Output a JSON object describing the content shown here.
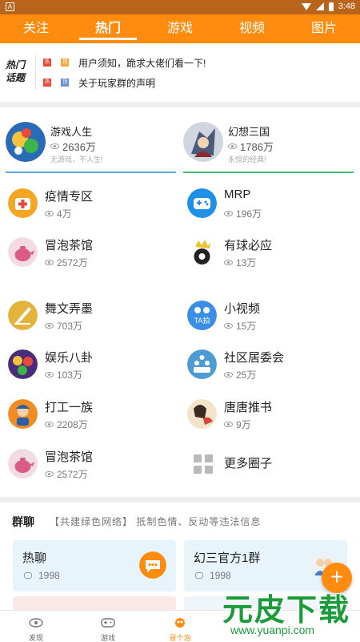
{
  "status_bar": {
    "time": "3:48",
    "left_icon": "A"
  },
  "top_tabs": [
    {
      "label": "关注",
      "active": false
    },
    {
      "label": "热门",
      "active": true
    },
    {
      "label": "游戏",
      "active": false
    },
    {
      "label": "视频",
      "active": false
    },
    {
      "label": "图片",
      "active": false
    }
  ],
  "hot_topics": {
    "logo_line1": "热门",
    "logo_line2": "话题",
    "items": [
      {
        "badge1": "热",
        "badge2": "顶",
        "text": "用户须知，跪求大佬们看一下!"
      },
      {
        "badge1": "热",
        "badge2": "顶",
        "text": "关于玩家群的声明"
      }
    ]
  },
  "featured": [
    {
      "name": "游戏人生",
      "views": "2636万",
      "slogan": "无游戏，不人生!",
      "underline_color": "#5aa9e6"
    },
    {
      "name": "幻想三国",
      "views": "1786万",
      "slogan": "永恒的经典!",
      "underline_color": "#3fbf6a"
    }
  ],
  "circles": [
    {
      "name": "疫情专区",
      "views": "4万"
    },
    {
      "name": "MRP",
      "views": "196万"
    },
    {
      "name": "冒泡茶馆",
      "views": "2572万"
    },
    {
      "name": "有球必应",
      "views": "13万"
    },
    {
      "name": "舞文弄墨",
      "views": "703万"
    },
    {
      "name": "小视频",
      "views": "15万"
    },
    {
      "name": "娱乐八卦",
      "views": "103万"
    },
    {
      "name": "社区居委会",
      "views": "25万"
    },
    {
      "name": "打工一族",
      "views": "2208万"
    },
    {
      "name": "唐唐推书",
      "views": "9万"
    },
    {
      "name": "冒泡茶馆",
      "views": "2572万"
    },
    {
      "name": "更多圈子",
      "views": ""
    }
  ],
  "video_badge": "TA拍",
  "group_chat": {
    "title": "群聊",
    "subtitle": "【共建绿色网络】 抵制色情、反动等违法信息",
    "cards": [
      {
        "name": "热聊",
        "count": "1998"
      },
      {
        "name": "幻三官方1群",
        "count": "1998"
      }
    ],
    "fab": "+"
  },
  "bottom_nav": [
    {
      "label": "发现",
      "active": false
    },
    {
      "label": "游戏",
      "active": false
    },
    {
      "label": "冒个泡",
      "active": true
    },
    {
      "label": "",
      "active": false
    },
    {
      "label": "",
      "active": false
    }
  ],
  "watermark": {
    "big": "元皮下载",
    "url": "www.yuanpi.com"
  },
  "colors": {
    "brand_orange": "#ff8c0f",
    "status_bar": "#b8641a",
    "card_bg": "#e8f4fb"
  }
}
